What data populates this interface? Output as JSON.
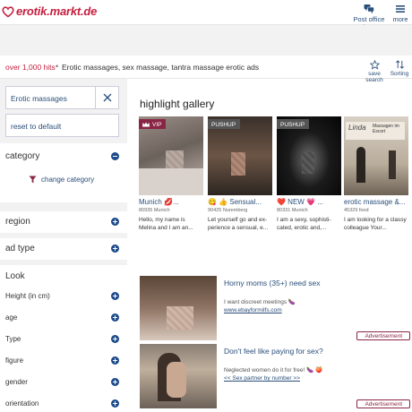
{
  "header": {
    "logo_text": "erotik.markt.de",
    "post_office_label": "Post office box",
    "more_label": "more"
  },
  "breadcrumb": {
    "hits": "over 1,000 hits",
    "separator": "•",
    "path": "Erotic massages, sex massage, tantra massage erotic ads",
    "save_search_label": "save search",
    "sorting_label": "Sorting"
  },
  "sidebar": {
    "search_value": "Erotic massages",
    "reset_label": "reset to default",
    "category": {
      "label": "category",
      "change_label": "change category"
    },
    "region_label": "region",
    "adtype_label": "ad type",
    "look": {
      "label": "Look",
      "rows": [
        "Height (in cm)",
        "age",
        "Type",
        "figure",
        "gender",
        "orientation"
      ]
    }
  },
  "gallery": {
    "title": "highlight gallery",
    "cards": [
      {
        "badge": "VIP",
        "name": "Munich 💋...",
        "loc": "80935 Munich",
        "desc": "Hello, my name is Melina and I am an..."
      },
      {
        "badge": "PUSHUP",
        "name": "😋 👍 Sensual...",
        "loc": "90425 Nuremberg",
        "desc": "Let yourself go and ex-perience a sensual, e..."
      },
      {
        "badge": "PUSHUP",
        "name": "❤️ NEW 💗 ...",
        "loc": "80331 Munich",
        "desc": "I am a sexy, sophisti-cated, erotic and,..."
      },
      {
        "badge": "",
        "name": "erotic massage &...",
        "loc": "45329 food",
        "desc": "I am looking for a classy colleague Your..."
      }
    ],
    "card4_sign": "Massagen im Escort",
    "card4_sign_script": "Linda"
  },
  "ads": [
    {
      "title": "Horny moms (35+) need sex",
      "line1": "I want discreet meetings 🍆",
      "line2": "www.ebayformilfs.com",
      "label": "Advertisement"
    },
    {
      "title": "Don't feel like paying for sex?",
      "line1": "Neglected women do it for free! 🍆 🍑",
      "line2": "<< Sex partner by number >>",
      "label": "Advertisement"
    }
  ],
  "colors": {
    "brand": "#c4203f",
    "link": "#2a4f7a",
    "accent": "#1e4b8a",
    "vip_badge": "#8a2645"
  }
}
